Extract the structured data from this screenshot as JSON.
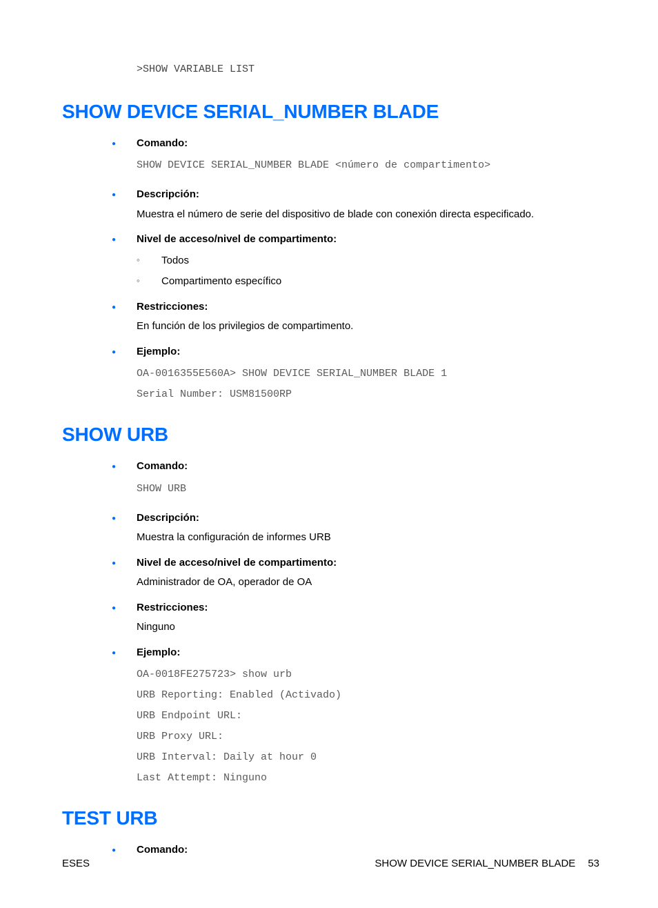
{
  "pre_top": ">SHOW VARIABLE LIST",
  "sections": [
    {
      "heading": "SHOW DEVICE SERIAL_NUMBER BLADE",
      "items": [
        {
          "label": "Comando:",
          "code": "SHOW DEVICE SERIAL_NUMBER BLADE <número de compartimento>"
        },
        {
          "label": "Descripción:",
          "text": "Muestra el número de serie del dispositivo de blade con conexión directa especificado."
        },
        {
          "label": "Nivel de acceso/nivel de compartimento:",
          "sub": [
            "Todos",
            "Compartimento específico"
          ]
        },
        {
          "label": "Restricciones:",
          "text": "En función de los privilegios de compartimento."
        },
        {
          "label": "Ejemplo:",
          "code": "OA-0016355E560A> SHOW DEVICE SERIAL_NUMBER BLADE 1\nSerial Number: USM81500RP"
        }
      ]
    },
    {
      "heading": "SHOW URB",
      "items": [
        {
          "label": "Comando:",
          "code": "SHOW URB"
        },
        {
          "label": "Descripción:",
          "text": "Muestra la configuración de informes URB"
        },
        {
          "label": "Nivel de acceso/nivel de compartimento:",
          "text": "Administrador de OA, operador de OA"
        },
        {
          "label": "Restricciones:",
          "text": "Ninguno"
        },
        {
          "label": "Ejemplo:",
          "code": "OA-0018FE275723> show urb\nURB Reporting: Enabled (Activado)\nURB Endpoint URL:\nURB Proxy URL:\nURB Interval: Daily at hour 0\nLast Attempt: Ninguno"
        }
      ]
    },
    {
      "heading": "TEST URB",
      "items": [
        {
          "label": "Comando:"
        }
      ]
    }
  ],
  "footer": {
    "left": "ESES",
    "right_text": "SHOW DEVICE SERIAL_NUMBER BLADE",
    "page_num": "53"
  }
}
